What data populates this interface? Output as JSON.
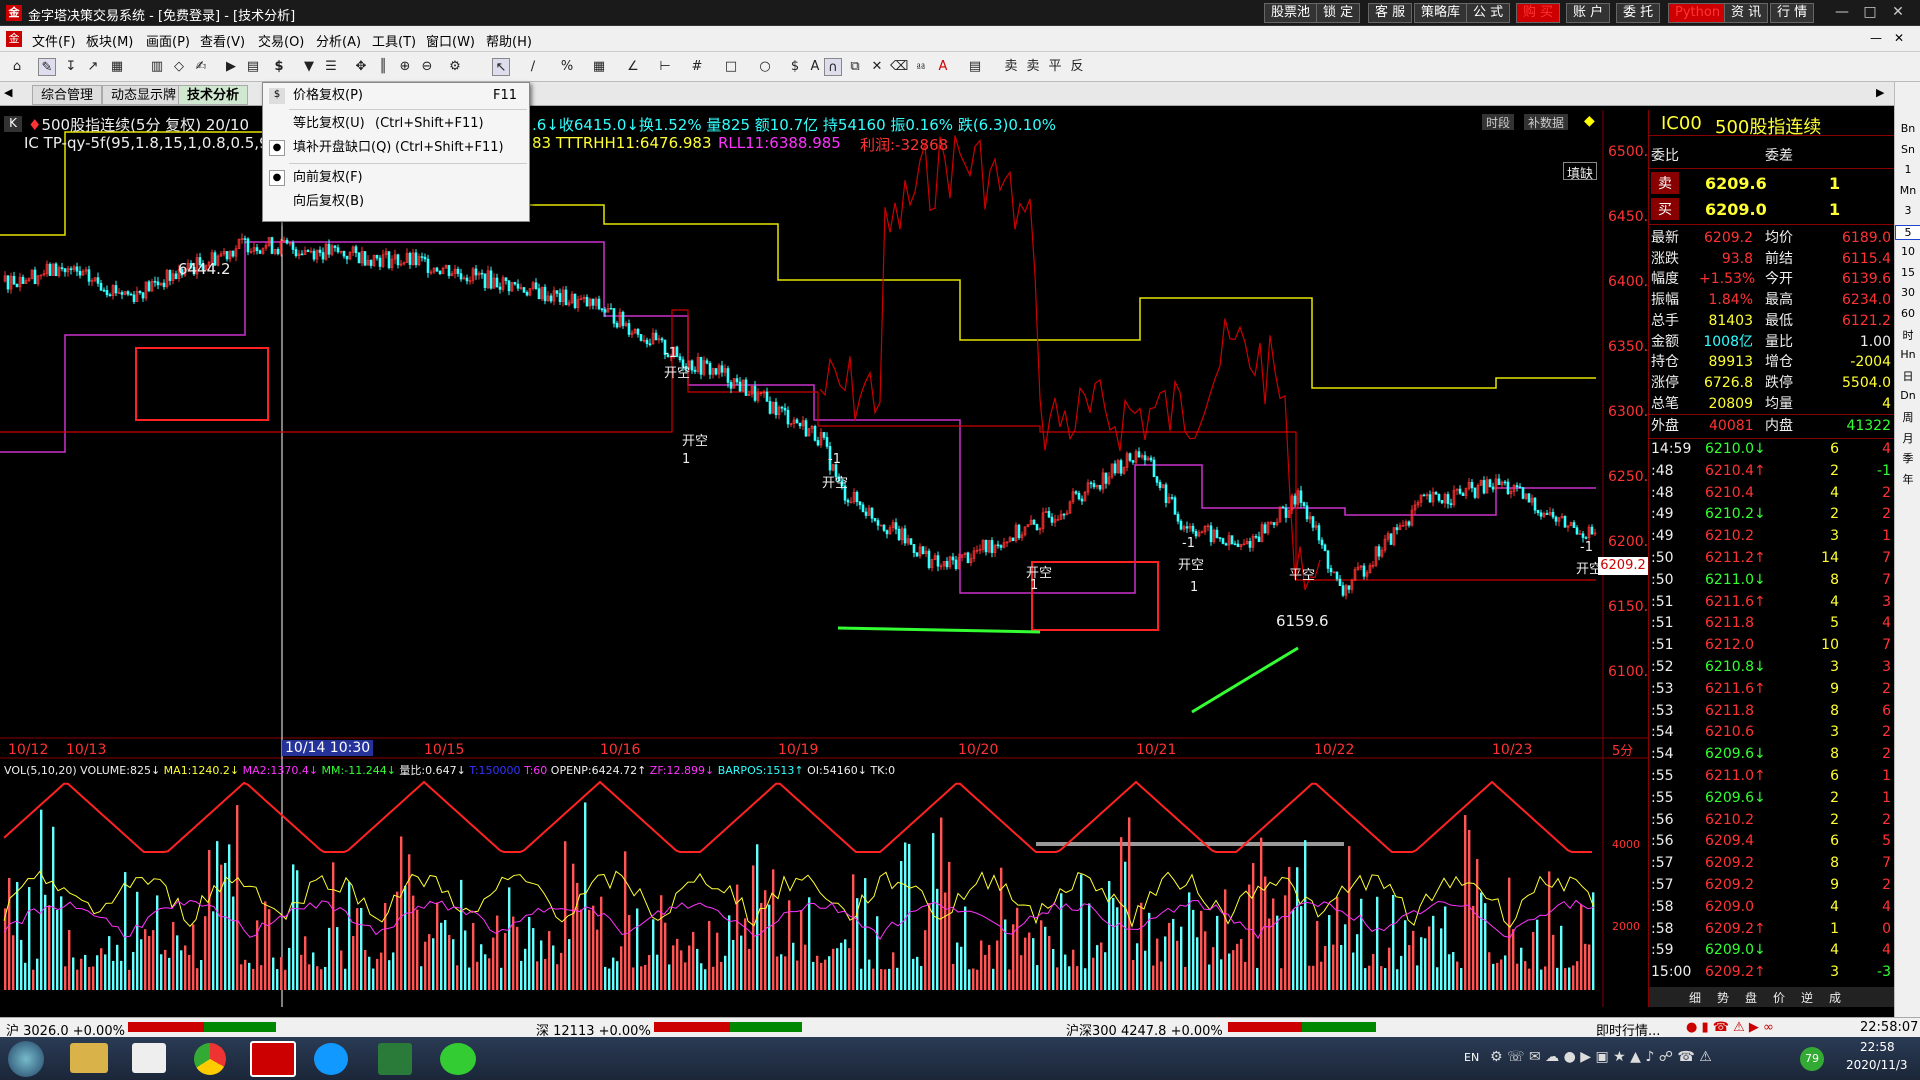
{
  "app": {
    "logo": "金",
    "title": "金字塔决策交易系统 - [免费登录] - [技术分析]",
    "top_buttons": [
      {
        "label": "股票池",
        "accent": false
      },
      {
        "label": "锁 定",
        "accent": false
      },
      {
        "label": "客 服",
        "accent": false
      },
      {
        "label": "策略库",
        "accent": false
      },
      {
        "label": "公 式",
        "accent": false
      },
      {
        "label": "购 买",
        "accent": true
      },
      {
        "label": "账 户",
        "accent": false
      },
      {
        "label": "委 托",
        "accent": false
      },
      {
        "label": "Python",
        "accent": true
      },
      {
        "label": "资 讯",
        "accent": false
      },
      {
        "label": "行 情",
        "accent": false
      }
    ]
  },
  "menu": [
    "文件(F)",
    "板块(M)",
    "画面(P)",
    "查看(V)",
    "交易(O)",
    "分析(A)",
    "工具(T)",
    "窗口(W)",
    "帮助(H)"
  ],
  "tabs": [
    "综合管理",
    "动态显示牌",
    "技术分析"
  ],
  "active_tab": 2,
  "dropdown": {
    "items": [
      {
        "label": "价格复权(P)",
        "shortcut": "F11",
        "checked": false,
        "icon": "$"
      },
      {
        "label": "等比复权(U)",
        "shortcut": "(Ctrl+Shift+F11)",
        "checked": false
      },
      {
        "label": "填补开盘缺口(Q)",
        "shortcut": "(Ctrl+Shift+F11)",
        "checked": true
      },
      {
        "label": "向前复权(F)",
        "shortcut": "",
        "checked": true
      },
      {
        "label": "向后复权(B)",
        "shortcut": "",
        "checked": false
      }
    ]
  },
  "chart_header": {
    "line1_left": "500股指连续(5分 复权) 20/10",
    "line1_right": ".6↓收6415.0↓换1.52% 量825 额10.7亿 持54160 振0.16% 跌(6.3)0.10%",
    "line2_left": "IC  TP-qy-5f(95,1.8,15,1,0.8,0.5,9",
    "line2_right_a": "83 TTTRHH11:6476.983",
    "line2_right_b": "RLL11:6388.985",
    "line2_right_c": "利润:-32868",
    "fill_label": "填缺",
    "btn_period": "时段",
    "btn_supp": "补数据"
  },
  "price_axis": [
    "6500.0",
    "6450.0",
    "6400.0",
    "6350.0",
    "6300.0",
    "6250.0",
    "6200.0",
    "6150.0",
    "6100.0"
  ],
  "current_price_tag": "6209.2",
  "annotations": {
    "high": "6444.2",
    "low": "6159.6"
  },
  "signal_labels": [
    "-1",
    "开空",
    "开空",
    "1",
    "-1",
    "开空",
    "开空",
    "1",
    "-1",
    "开空",
    "1",
    "平空",
    "-1",
    "开空"
  ],
  "date_axis": [
    "10/12",
    "10/13",
    "10/14",
    "10/15",
    "10/16",
    "10/19",
    "10/20",
    "10/21",
    "10/22",
    "10/23"
  ],
  "cursor_date": "10/14 10:30",
  "period_label": "5分",
  "vol_header": {
    "vol": "VOL(5,10,20) VOLUME:825↓",
    "ma1": "MA1:1240.2↓",
    "ma2": "MA2:1370.4↓",
    "mm": "MM:-11.244↓",
    "ratio": "量比:0.647↓",
    "t1": "T:150000",
    "t2": "T:60",
    "openp": "OPENP:6424.72↑",
    "zf": "ZF:12.899↓",
    "barpos": "BARPOS:1513↑",
    "oi": "OI:54160↓",
    "tk": "TK:0"
  },
  "vol_axis": [
    "4000",
    "2000"
  ],
  "quote": {
    "code": "IC00",
    "name": "500股指连续",
    "weibi_label": "委比",
    "weicha_label": "委差",
    "sell_label": "卖",
    "sell_price": "6209.6",
    "sell_vol": "1",
    "buy_label": "买",
    "buy_price": "6209.0",
    "buy_vol": "1",
    "stats": [
      [
        "最新",
        "6209.2",
        "均价",
        "6189.0"
      ],
      [
        "涨跌",
        "93.8",
        "前结",
        "6115.4"
      ],
      [
        "幅度",
        "+1.53%",
        "今开",
        "6139.6"
      ],
      [
        "振幅",
        "1.84%",
        "最高",
        "6234.0"
      ],
      [
        "总手",
        "81403",
        "最低",
        "6121.2"
      ],
      [
        "金额",
        "1008亿",
        "量比",
        "1.00"
      ],
      [
        "持仓",
        "89913",
        "增仓",
        "-2004"
      ],
      [
        "涨停",
        "6726.8",
        "跌停",
        "5504.0"
      ],
      [
        "总笔",
        "20809",
        "均量",
        "4"
      ]
    ],
    "outer_label": "外盘",
    "outer": "40081",
    "inner_label": "内盘",
    "inner": "41322"
  },
  "ticks": [
    [
      "14:59",
      "6210.0↓",
      "6",
      "4"
    ],
    [
      ":48",
      "6210.4↑",
      "2",
      "-1"
    ],
    [
      ":48",
      "6210.4",
      "4",
      "2"
    ],
    [
      ":49",
      "6210.2↓",
      "2",
      "2"
    ],
    [
      ":49",
      "6210.2",
      "3",
      "1"
    ],
    [
      ":50",
      "6211.2↑",
      "14",
      "7"
    ],
    [
      ":50",
      "6211.0↓",
      "8",
      "7"
    ],
    [
      ":51",
      "6211.6↑",
      "4",
      "3"
    ],
    [
      ":51",
      "6211.8",
      "5",
      "4"
    ],
    [
      ":51",
      "6212.0",
      "10",
      "7"
    ],
    [
      ":52",
      "6210.8↓",
      "3",
      "3"
    ],
    [
      ":53",
      "6211.6↑",
      "9",
      "2"
    ],
    [
      ":53",
      "6211.8",
      "8",
      "6"
    ],
    [
      ":54",
      "6210.6",
      "3",
      "2"
    ],
    [
      ":54",
      "6209.6↓",
      "8",
      "2"
    ],
    [
      ":55",
      "6211.0↑",
      "6",
      "1"
    ],
    [
      ":55",
      "6209.6↓",
      "2",
      "1"
    ],
    [
      ":56",
      "6210.2",
      "2",
      "2"
    ],
    [
      ":56",
      "6209.4",
      "6",
      "5"
    ],
    [
      ":57",
      "6209.2",
      "8",
      "7"
    ],
    [
      ":57",
      "6209.2",
      "9",
      "2"
    ],
    [
      ":58",
      "6209.0",
      "4",
      "4"
    ],
    [
      ":58",
      "6209.2↑",
      "1",
      "0"
    ],
    [
      ":59",
      "6209.0↓",
      "4",
      "4"
    ],
    [
      "15:00",
      "6209.2↑",
      "3",
      "-3"
    ]
  ],
  "bottom_tabs": [
    "细",
    "势",
    "盘",
    "价",
    "逆",
    "成"
  ],
  "sidebar": [
    "Bn",
    "Sn",
    "1",
    "Mn",
    "3",
    "5",
    "10",
    "15",
    "30",
    "60",
    "时",
    "Hn",
    "日",
    "Dn",
    "周",
    "月",
    "季",
    "年"
  ],
  "status": {
    "sh": "沪 3026.0 +0.00%",
    "sz": "深 12113 +0.00%",
    "hs300": "沪深300   4247.8 +0.00%",
    "live": "即时行情...",
    "time": "22:58:07"
  },
  "taskbar": {
    "time": "22:58",
    "date": "2020/11/3",
    "lang": "EN",
    "badge": "79"
  },
  "colors": {
    "up": "#ff3333",
    "down": "#33ffff",
    "upper_band": "#e6e600",
    "lower_band": "#cc33cc",
    "midline": "#cc0000",
    "trend": "#33ff33"
  }
}
